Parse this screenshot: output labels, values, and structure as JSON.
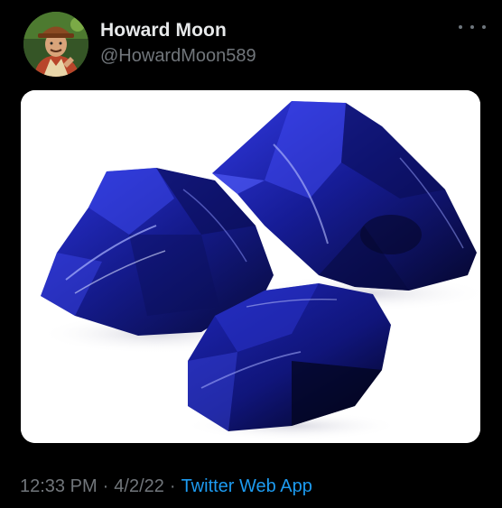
{
  "tweet": {
    "author": {
      "display_name": "Howard Moon",
      "handle": "@HowardMoon589",
      "avatar_icon": "avatar-photo"
    },
    "more_icon": "more-options-icon",
    "media": {
      "subject": "three-cobalt-blue-glass-rocks",
      "background": "#ffffff",
      "rock_color": "#1a1f9e"
    },
    "meta": {
      "time": "12:33 PM",
      "separator": "·",
      "date": "4/2/22",
      "source": "Twitter Web App"
    }
  },
  "colors": {
    "background": "#000000",
    "primary_text": "#e7e9ea",
    "secondary_text": "#71767b",
    "link": "#1d9bf0"
  }
}
